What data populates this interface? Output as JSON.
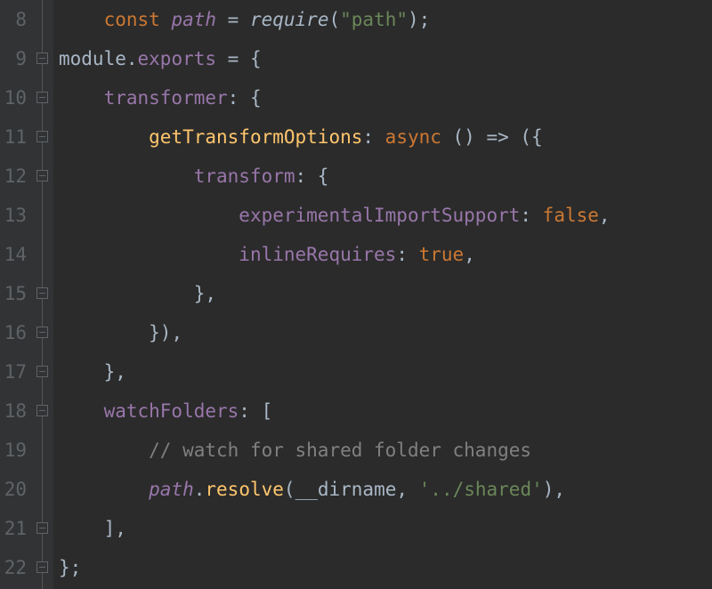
{
  "gutter": {
    "start": 8,
    "end": 22
  },
  "fold_markers": [
    1,
    2,
    3,
    4,
    7,
    8,
    9,
    10,
    13,
    14
  ],
  "code": {
    "l8": {
      "kw_const": "const",
      "var_path": "path",
      "punct_eq": " = ",
      "fn_require": "require",
      "punct_open": "(",
      "str_path": "\"path\"",
      "punct_close": ");"
    },
    "l9": {
      "prop_module": "module",
      "punct_dot": ".",
      "prop_exports": "exports",
      "punct_eq": " = {",
      "indent": ""
    },
    "l10": {
      "prop_transformer": "transformer",
      "punct": ": {"
    },
    "l11": {
      "fn_getTransformOptions": "getTransformOptions",
      "punct_colon": ": ",
      "kw_async": "async",
      "punct_rest": " () => ({"
    },
    "l12": {
      "prop_transform": "transform",
      "punct": ": {"
    },
    "l13": {
      "prop_experimental": "experimentalImportSupport",
      "punct": ": ",
      "val_false": "false",
      "punct_comma": ","
    },
    "l14": {
      "prop_inline": "inlineRequires",
      "punct": ": ",
      "val_true": "true",
      "punct_comma": ","
    },
    "l15": {
      "punct": "},"
    },
    "l16": {
      "punct": "}),"
    },
    "l17": {
      "punct": "},"
    },
    "l18": {
      "prop_watch": "watchFolders",
      "punct": ": ["
    },
    "l19": {
      "comment": "// watch for shared folder changes"
    },
    "l20": {
      "var_path": "path",
      "punct_dot": ".",
      "fn_resolve": "resolve",
      "punct_open": "(",
      "var_dirname": "__dirname",
      "punct_comma": ", ",
      "str_shared": "'../shared'",
      "punct_close": "),"
    },
    "l21": {
      "punct": "],"
    },
    "l22": {
      "punct": "};"
    }
  },
  "indent_unit": "    "
}
